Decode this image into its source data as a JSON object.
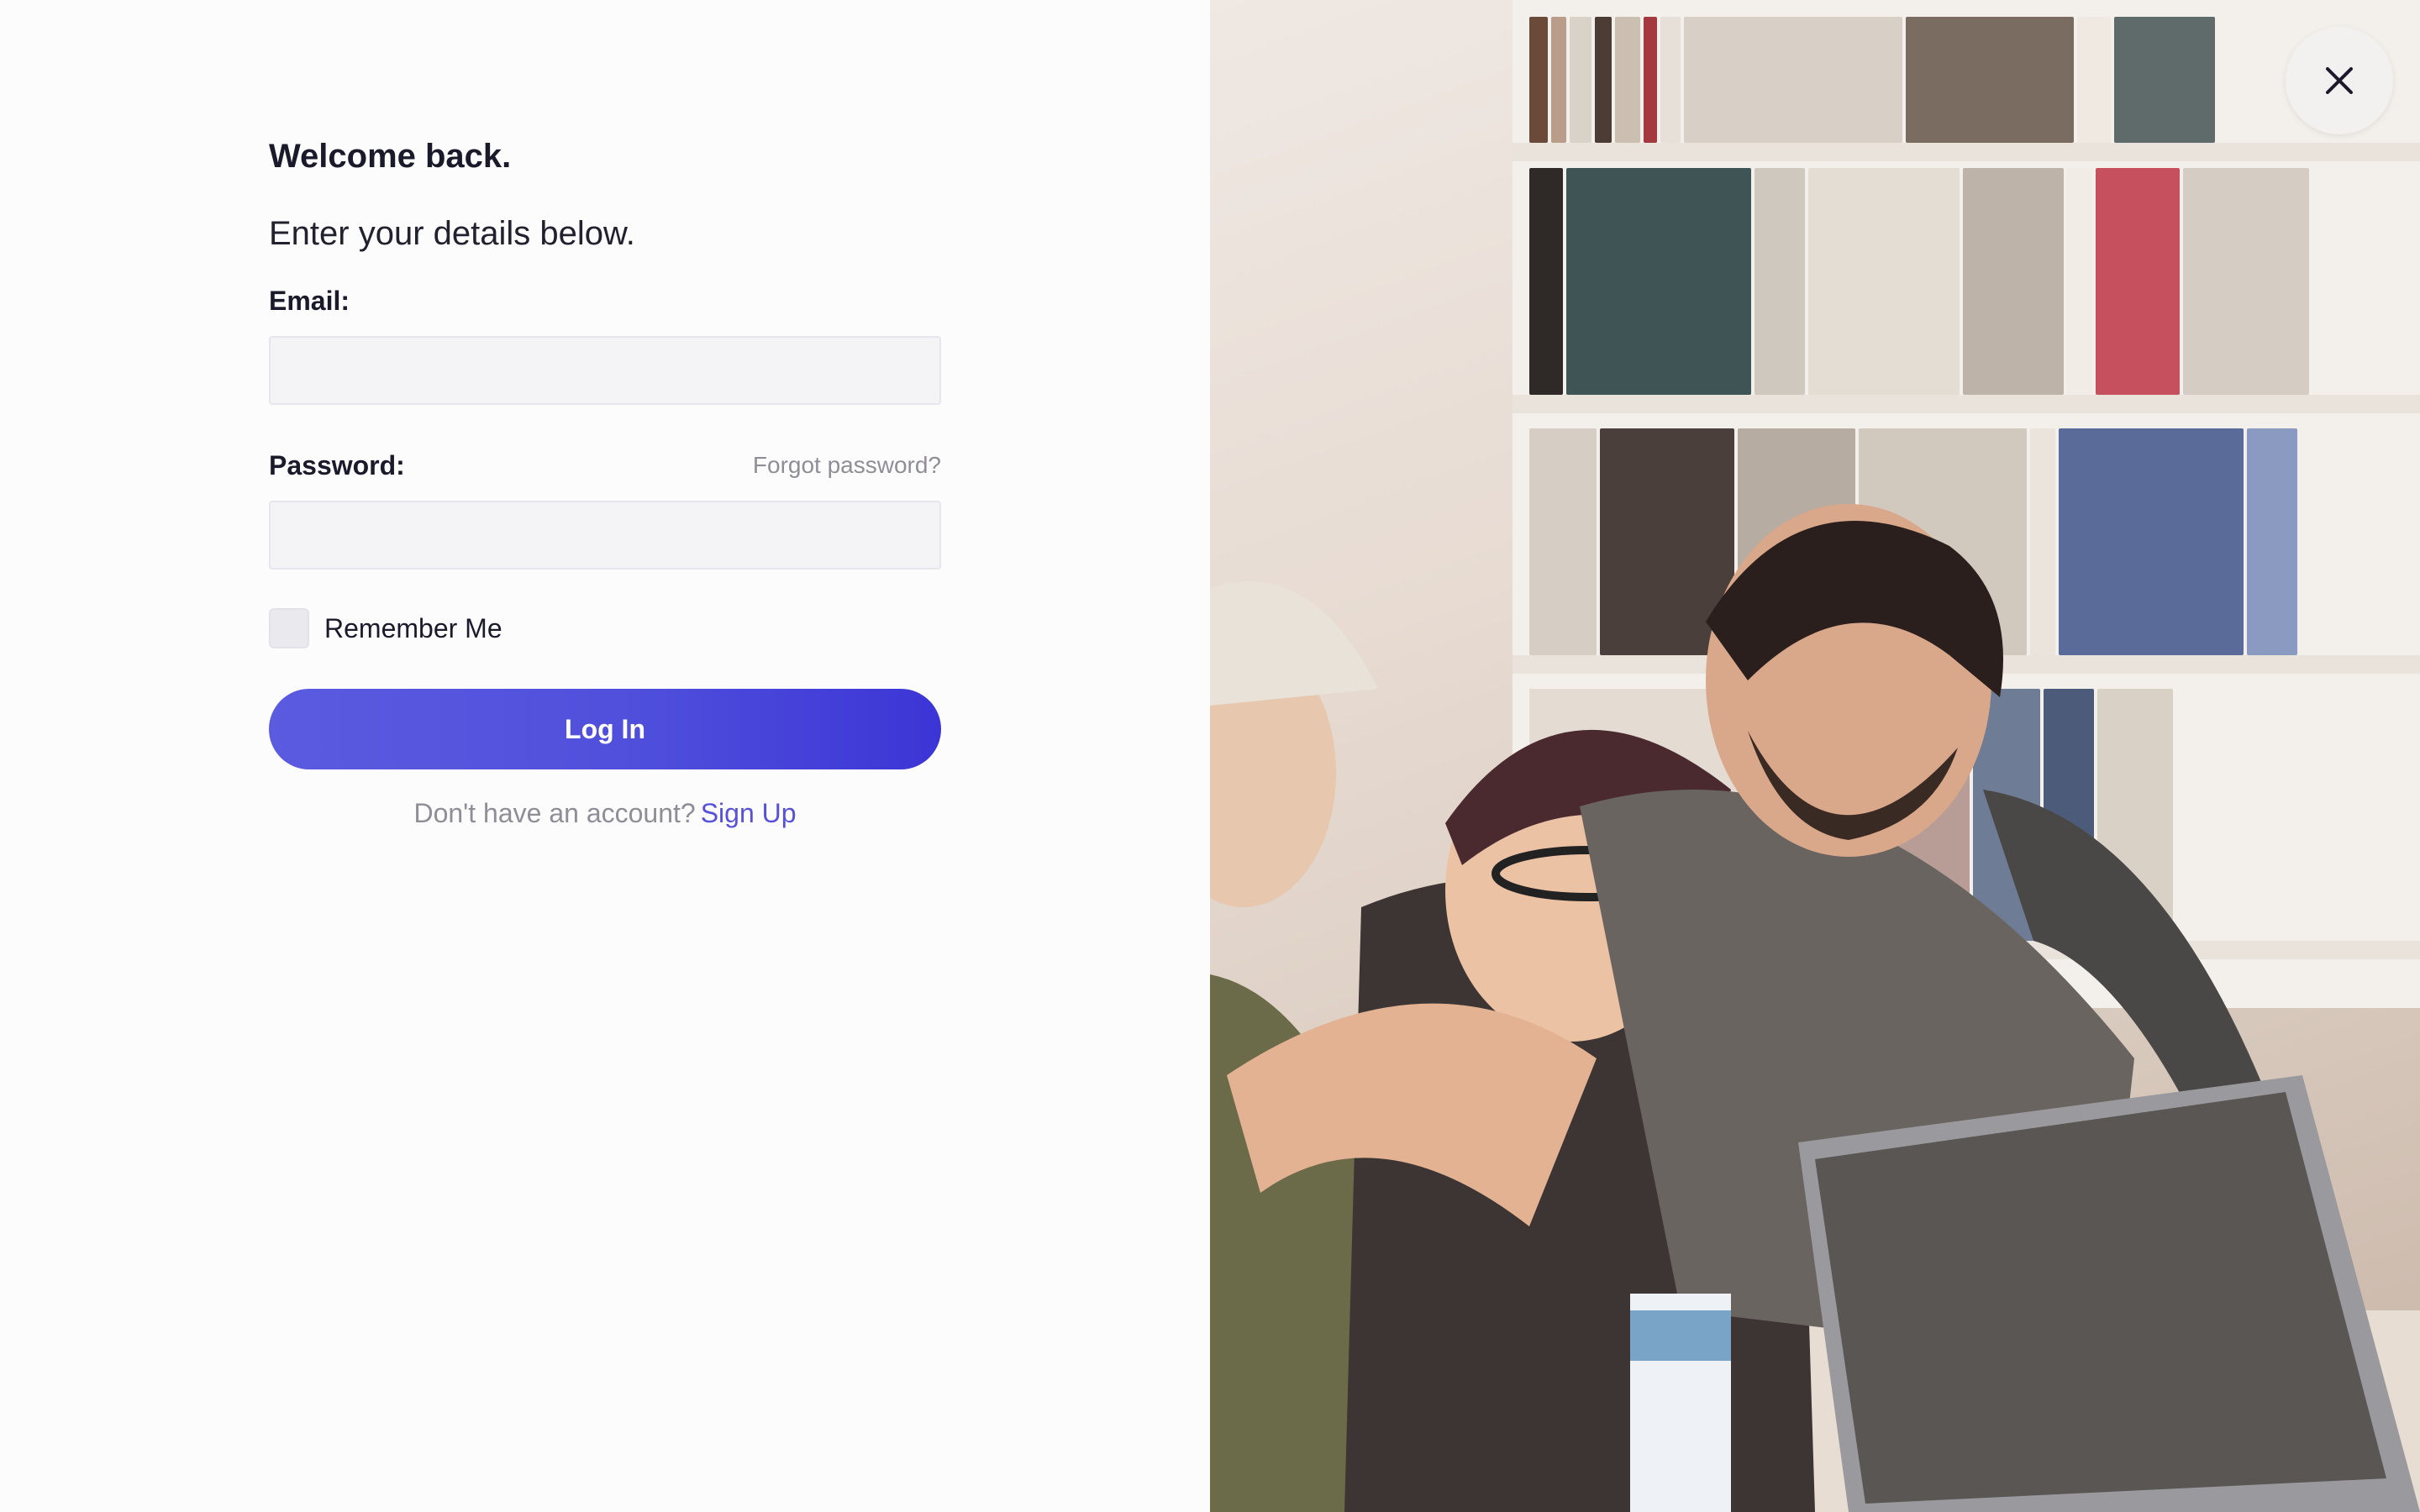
{
  "login": {
    "title": "Welcome back.",
    "subtitle": "Enter your details below.",
    "email_label": "Email:",
    "email_value": "",
    "password_label": "Password:",
    "password_value": "",
    "forgot_password": "Forgot password?",
    "remember_me": "Remember Me",
    "remember_checked": false,
    "login_button": "Log In",
    "signup_prompt": "Don't have an account?",
    "signup_link": "Sign Up"
  },
  "colors": {
    "accent": "#4f4fdc",
    "link": "#5651d8",
    "muted_text": "#8f8d96",
    "input_bg": "#f4f4f7"
  },
  "icons": {
    "close": "close-icon"
  }
}
